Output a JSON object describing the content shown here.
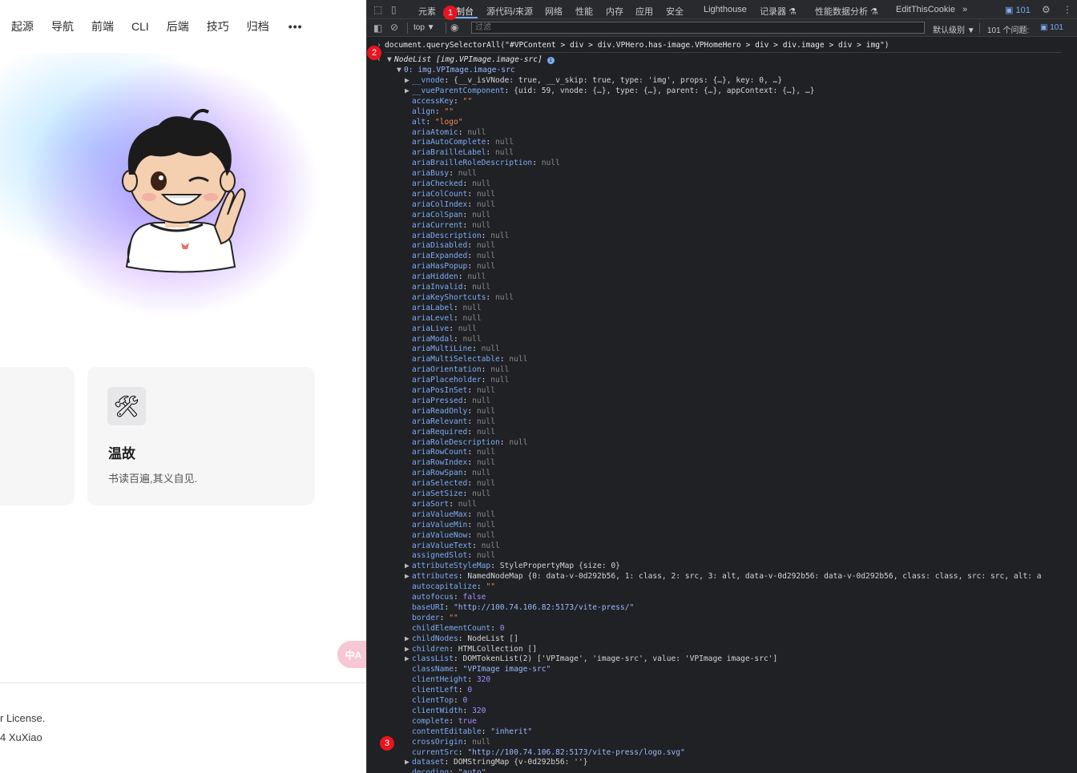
{
  "page": {
    "nav": [
      "起源",
      "导航",
      "前端",
      "CLI",
      "后端",
      "技巧",
      "归档"
    ],
    "nav_more": "•••",
    "card": {
      "icon": "🛠",
      "title": "温故",
      "desc": "书读百遍,其义自见."
    },
    "translate_label": "中A",
    "footer_line1": "r License.",
    "footer_line2": "4 XuXiao"
  },
  "devtools": {
    "tabs": [
      "元素",
      "控制台",
      "源代码/来源",
      "网络",
      "性能",
      "内存",
      "应用",
      "安全",
      "Lighthouse",
      "记录器 ⚗",
      "性能数据分析 ⚗",
      "EditThisCookie",
      "»"
    ],
    "issues_badge": "101",
    "context": "top ▼",
    "filter_placeholder": "过滤",
    "level": "默认级别 ▼",
    "issues_text": "101 个问题:",
    "issues_count": "101",
    "command": "document.querySelectorAll(\"#VPContent > div > div.VPHero.has-image.VPHomeHero > div > div.image > div > img\")",
    "result_header": "NodeList [img.VPImage.image-src]",
    "item0": "0: img.VPImage.image-src",
    "badges": [
      "1",
      "2",
      "3"
    ],
    "props": [
      {
        "t": "▶",
        "k": "__vnode",
        "v": "{__v_isVNode: true, __v_skip: true, type: 'img', props: {…}, key: 0, …}",
        "c": "v-plain"
      },
      {
        "t": "▶",
        "k": "__vueParentComponent",
        "v": "{uid: 59, vnode: {…}, type: {…}, parent: {…}, appContext: {…}, …}",
        "c": "v-plain"
      },
      {
        "t": "",
        "k": "accessKey",
        "v": "\"\"",
        "c": "v-str"
      },
      {
        "t": "",
        "k": "align",
        "v": "\"\"",
        "c": "v-str"
      },
      {
        "t": "",
        "k": "alt",
        "v": "\"logo\"",
        "c": "v-str"
      },
      {
        "t": "",
        "k": "ariaAtomic",
        "v": "null",
        "c": "v-null"
      },
      {
        "t": "",
        "k": "ariaAutoComplete",
        "v": "null",
        "c": "v-null"
      },
      {
        "t": "",
        "k": "ariaBrailleLabel",
        "v": "null",
        "c": "v-null"
      },
      {
        "t": "",
        "k": "ariaBrailleRoleDescription",
        "v": "null",
        "c": "v-null"
      },
      {
        "t": "",
        "k": "ariaBusy",
        "v": "null",
        "c": "v-null"
      },
      {
        "t": "",
        "k": "ariaChecked",
        "v": "null",
        "c": "v-null"
      },
      {
        "t": "",
        "k": "ariaColCount",
        "v": "null",
        "c": "v-null"
      },
      {
        "t": "",
        "k": "ariaColIndex",
        "v": "null",
        "c": "v-null"
      },
      {
        "t": "",
        "k": "ariaColSpan",
        "v": "null",
        "c": "v-null"
      },
      {
        "t": "",
        "k": "ariaCurrent",
        "v": "null",
        "c": "v-null"
      },
      {
        "t": "",
        "k": "ariaDescription",
        "v": "null",
        "c": "v-null"
      },
      {
        "t": "",
        "k": "ariaDisabled",
        "v": "null",
        "c": "v-null"
      },
      {
        "t": "",
        "k": "ariaExpanded",
        "v": "null",
        "c": "v-null"
      },
      {
        "t": "",
        "k": "ariaHasPopup",
        "v": "null",
        "c": "v-null"
      },
      {
        "t": "",
        "k": "ariaHidden",
        "v": "null",
        "c": "v-null"
      },
      {
        "t": "",
        "k": "ariaInvalid",
        "v": "null",
        "c": "v-null"
      },
      {
        "t": "",
        "k": "ariaKeyShortcuts",
        "v": "null",
        "c": "v-null"
      },
      {
        "t": "",
        "k": "ariaLabel",
        "v": "null",
        "c": "v-null"
      },
      {
        "t": "",
        "k": "ariaLevel",
        "v": "null",
        "c": "v-null"
      },
      {
        "t": "",
        "k": "ariaLive",
        "v": "null",
        "c": "v-null"
      },
      {
        "t": "",
        "k": "ariaModal",
        "v": "null",
        "c": "v-null"
      },
      {
        "t": "",
        "k": "ariaMultiLine",
        "v": "null",
        "c": "v-null"
      },
      {
        "t": "",
        "k": "ariaMultiSelectable",
        "v": "null",
        "c": "v-null"
      },
      {
        "t": "",
        "k": "ariaOrientation",
        "v": "null",
        "c": "v-null"
      },
      {
        "t": "",
        "k": "ariaPlaceholder",
        "v": "null",
        "c": "v-null"
      },
      {
        "t": "",
        "k": "ariaPosInSet",
        "v": "null",
        "c": "v-null"
      },
      {
        "t": "",
        "k": "ariaPressed",
        "v": "null",
        "c": "v-null"
      },
      {
        "t": "",
        "k": "ariaReadOnly",
        "v": "null",
        "c": "v-null"
      },
      {
        "t": "",
        "k": "ariaRelevant",
        "v": "null",
        "c": "v-null"
      },
      {
        "t": "",
        "k": "ariaRequired",
        "v": "null",
        "c": "v-null"
      },
      {
        "t": "",
        "k": "ariaRoleDescription",
        "v": "null",
        "c": "v-null"
      },
      {
        "t": "",
        "k": "ariaRowCount",
        "v": "null",
        "c": "v-null"
      },
      {
        "t": "",
        "k": "ariaRowIndex",
        "v": "null",
        "c": "v-null"
      },
      {
        "t": "",
        "k": "ariaRowSpan",
        "v": "null",
        "c": "v-null"
      },
      {
        "t": "",
        "k": "ariaSelected",
        "v": "null",
        "c": "v-null"
      },
      {
        "t": "",
        "k": "ariaSetSize",
        "v": "null",
        "c": "v-null"
      },
      {
        "t": "",
        "k": "ariaSort",
        "v": "null",
        "c": "v-null"
      },
      {
        "t": "",
        "k": "ariaValueMax",
        "v": "null",
        "c": "v-null"
      },
      {
        "t": "",
        "k": "ariaValueMin",
        "v": "null",
        "c": "v-null"
      },
      {
        "t": "",
        "k": "ariaValueNow",
        "v": "null",
        "c": "v-null"
      },
      {
        "t": "",
        "k": "ariaValueText",
        "v": "null",
        "c": "v-null"
      },
      {
        "t": "",
        "k": "assignedSlot",
        "v": "null",
        "c": "v-null"
      },
      {
        "t": "▶",
        "k": "attributeStyleMap",
        "v": "StylePropertyMap {size: 0}",
        "c": "v-plain"
      },
      {
        "t": "▶",
        "k": "attributes",
        "v": "NamedNodeMap {0: data-v-0d292b56, 1: class, 2: src, 3: alt, data-v-0d292b56: data-v-0d292b56, class: class, src: src, alt: a",
        "c": "v-plain"
      },
      {
        "t": "",
        "k": "autocapitalize",
        "v": "\"\"",
        "c": "v-str"
      },
      {
        "t": "",
        "k": "autofocus",
        "v": "false",
        "c": "v-bool"
      },
      {
        "t": "",
        "k": "baseURI",
        "v": "\"http://100.74.106.82:5173/vite-press/\"",
        "c": "v-strb"
      },
      {
        "t": "",
        "k": "border",
        "v": "\"\"",
        "c": "v-str"
      },
      {
        "t": "",
        "k": "childElementCount",
        "v": "0",
        "c": "v-num"
      },
      {
        "t": "▶",
        "k": "childNodes",
        "v": "NodeList []",
        "c": "v-plain"
      },
      {
        "t": "▶",
        "k": "children",
        "v": "HTMLCollection []",
        "c": "v-plain"
      },
      {
        "t": "▶",
        "k": "classList",
        "v": "DOMTokenList(2) ['VPImage', 'image-src', value: 'VPImage image-src']",
        "c": "v-plain"
      },
      {
        "t": "",
        "k": "className",
        "v": "\"VPImage image-src\"",
        "c": "v-strb"
      },
      {
        "t": "",
        "k": "clientHeight",
        "v": "320",
        "c": "v-num"
      },
      {
        "t": "",
        "k": "clientLeft",
        "v": "0",
        "c": "v-num"
      },
      {
        "t": "",
        "k": "clientTop",
        "v": "0",
        "c": "v-num"
      },
      {
        "t": "",
        "k": "clientWidth",
        "v": "320",
        "c": "v-num"
      },
      {
        "t": "",
        "k": "complete",
        "v": "true",
        "c": "v-bool"
      },
      {
        "t": "",
        "k": "contentEditable",
        "v": "\"inherit\"",
        "c": "v-strb"
      },
      {
        "t": "",
        "k": "crossOrigin",
        "v": "null",
        "c": "v-null"
      },
      {
        "t": "",
        "k": "currentSrc",
        "v": "\"http://100.74.106.82:5173/vite-press/logo.svg\"",
        "c": "v-strb"
      },
      {
        "t": "▶",
        "k": "dataset",
        "v": "DOMStringMap {v-0d292b56: ''}",
        "c": "v-plain"
      },
      {
        "t": "",
        "k": "decoding",
        "v": "\"auto\"",
        "c": "v-strb"
      }
    ]
  }
}
